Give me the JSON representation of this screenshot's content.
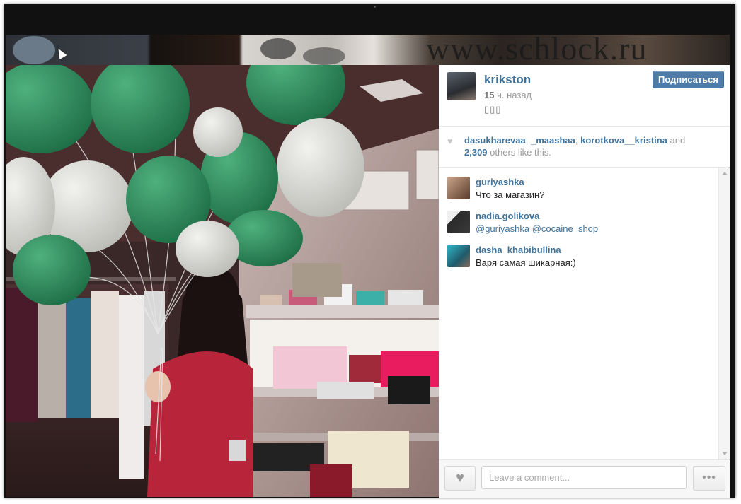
{
  "watermark": "www.schlock.ru",
  "post": {
    "owner": "krikston",
    "time_number": "15",
    "time_unit": "ч. назад",
    "caption": "▯▯▯",
    "follow_label": "Подписаться"
  },
  "likes": {
    "users": [
      "dasukharevaa",
      "_maashaa",
      "korotkova__kristina"
    ],
    "separator": ", ",
    "and_word": " and",
    "others_count": "2,309",
    "others_text": " others like this."
  },
  "comments": [
    {
      "user": "guriyashka",
      "text": "Что за магазин?"
    },
    {
      "user": "nadia.golikova",
      "mention1": "@guriyashka",
      "mention2": "@cocaine",
      "text": "shop"
    },
    {
      "user": "dasha_khabibullina",
      "text": "Варя самая шикарная:)"
    }
  ],
  "footer": {
    "comment_placeholder": "Leave a comment...",
    "more_label": "•••"
  },
  "icons": {
    "like": "heart-icon",
    "more": "ellipsis-icon",
    "cursor": "mouse-cursor-icon"
  },
  "colors": {
    "link_blue": "#3f729b",
    "follow_button": "#4e7ba8",
    "balloon_green": "#2e8a5a"
  }
}
